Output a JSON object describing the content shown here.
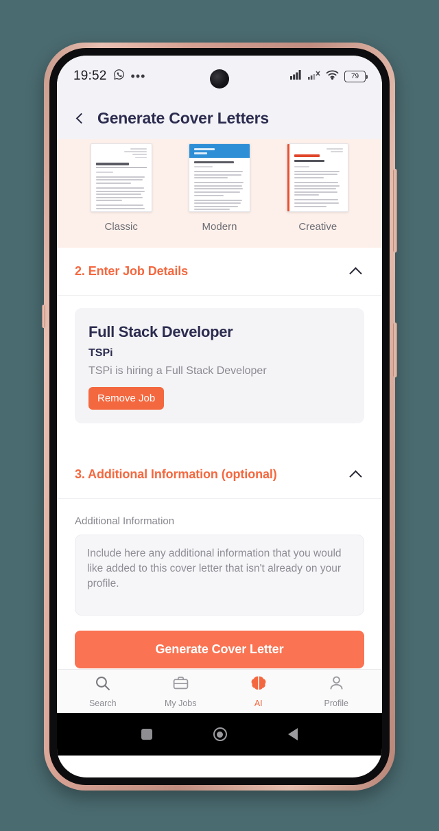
{
  "status_bar": {
    "time": "19:52",
    "whatsapp_icon": "whatsapp-icon",
    "more_icon": "•••",
    "signal_icon": "signal-bars-icon",
    "signal_off_icon": "signal-no-sim-icon",
    "wifi_icon": "wifi-icon",
    "battery_level": "79"
  },
  "header": {
    "back_label": "back",
    "title": "Generate Cover Letters"
  },
  "templates": {
    "items": [
      {
        "label": "Classic",
        "style": "classic"
      },
      {
        "label": "Modern",
        "style": "modern"
      },
      {
        "label": "Creative",
        "style": "creative"
      }
    ]
  },
  "section_job": {
    "title": "2. Enter Job Details",
    "collapse_icon": "chevron-up-icon",
    "job": {
      "title": "Full Stack Developer",
      "company": "TSPi",
      "description": "TSPi is hiring a Full Stack Developer",
      "remove_label": "Remove Job"
    }
  },
  "section_additional": {
    "title": "3. Additional Information (optional)",
    "collapse_icon": "chevron-up-icon",
    "field_label": "Additional Information",
    "placeholder": "Include here any additional information that you would like added to this cover letter that isn't already on your profile.",
    "value": ""
  },
  "cta": {
    "label": "Generate Cover Letter"
  },
  "bottom_nav": {
    "items": [
      {
        "label": "Search",
        "icon": "search-icon",
        "active": false
      },
      {
        "label": "My Jobs",
        "icon": "briefcase-icon",
        "active": false
      },
      {
        "label": "AI",
        "icon": "brain-icon",
        "active": true
      },
      {
        "label": "Profile",
        "icon": "person-icon",
        "active": false
      }
    ]
  },
  "android_nav": {
    "recents": "recents-square-icon",
    "home": "home-circle-icon",
    "back": "back-triangle-icon"
  },
  "colors": {
    "accent": "#f4683f",
    "cta": "#fa7352",
    "title": "#2c2c50",
    "page_bg": "#4a6b70",
    "template_bg": "#fdf0ea"
  }
}
